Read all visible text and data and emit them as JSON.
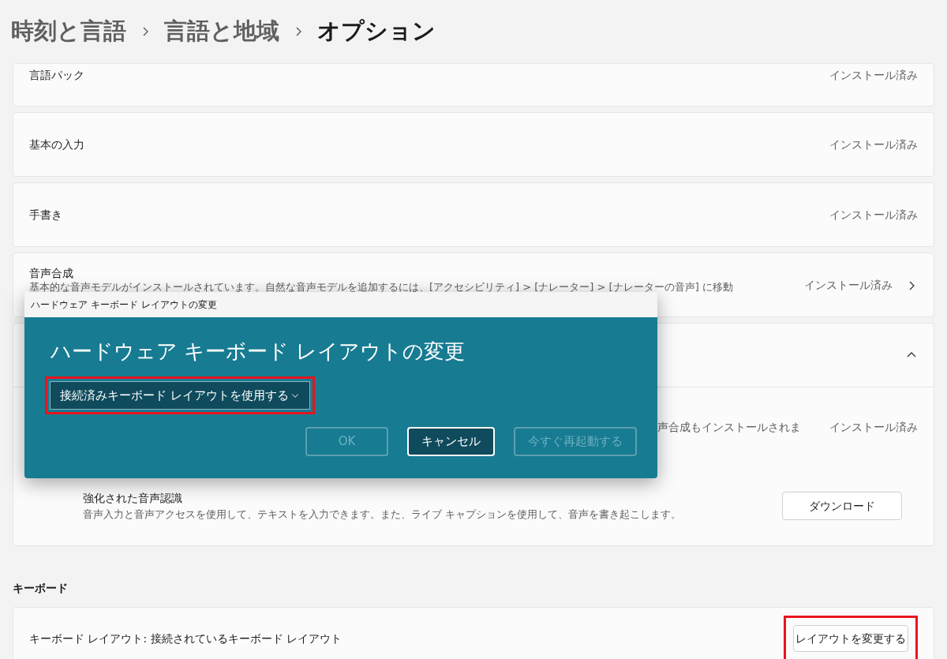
{
  "breadcrumb": [
    "時刻と言語",
    "言語と地域",
    "オプション"
  ],
  "features": [
    {
      "kind": "status",
      "title": "言語パック",
      "status": "インストール済み"
    },
    {
      "kind": "status",
      "title": "基本の入力",
      "status": "インストール済み"
    },
    {
      "kind": "status",
      "title": "手書き",
      "status": "インストール済み"
    },
    {
      "kind": "link",
      "title": "音声合成",
      "description": "基本的な音声モデルがインストールされています。自然な音声モデルを追加するには、[アクセシビリティ] > [ナレーター] > [ナレーターの音声] に移動",
      "status": "インストール済み"
    },
    {
      "kind": "expander",
      "expanded": true,
      "children": [
        {
          "kind": "status",
          "description": "声合成もインストールされま",
          "status": "インストール済み"
        },
        {
          "kind": "download",
          "title": "強化された音声認識",
          "description": "音声入力と音声アクセスを使用して、テキストを入力できます。また、ライブ キャプションを使用して、音声を書き起こします。",
          "button": "ダウンロード"
        }
      ]
    }
  ],
  "keyboard": {
    "heading": "キーボード",
    "label": "キーボード レイアウト: 接続されているキーボード レイアウト",
    "button": "レイアウトを変更する",
    "highlighted": true
  },
  "dialog": {
    "window_title": "ハードウェア キーボード レイアウトの変更",
    "heading": "ハードウェア キーボード レイアウトの変更",
    "dropdown": {
      "value": "接続済みキーボード レイアウトを使用する",
      "highlighted": true
    },
    "buttons": [
      {
        "label": "OK",
        "disabled": true
      },
      {
        "label": "キャンセル",
        "disabled": false
      },
      {
        "label": "今すぐ再起動する",
        "disabled": true
      }
    ]
  }
}
